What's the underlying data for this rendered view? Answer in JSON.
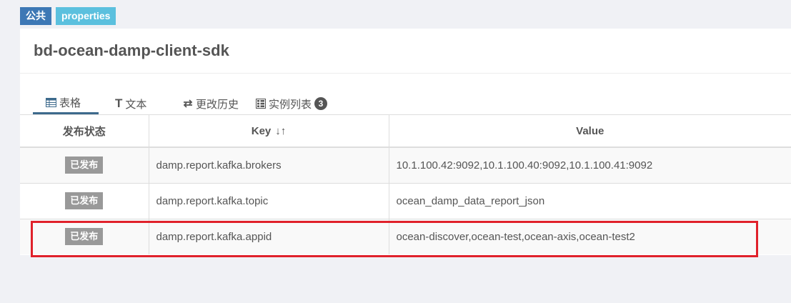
{
  "badges": {
    "scope": "公共",
    "format": "properties"
  },
  "namespace": {
    "title": "bd-ocean-damp-client-sdk"
  },
  "tabs": [
    {
      "label": "表格",
      "icon": "table-icon"
    },
    {
      "label": "文本",
      "icon": "text-icon"
    },
    {
      "label": "更改历史",
      "icon": "history-icon"
    },
    {
      "label": "实例列表",
      "icon": "instance-list-icon",
      "count": "3"
    }
  ],
  "table": {
    "headers": {
      "status": "发布状态",
      "key": "Key",
      "value": "Value"
    },
    "rows": [
      {
        "status": "已发布",
        "key": "damp.report.kafka.brokers",
        "value": "10.1.100.42:9092,10.1.100.40:9092,10.1.100.41:9092"
      },
      {
        "status": "已发布",
        "key": "damp.report.kafka.topic",
        "value": "ocean_damp_data_report_json"
      },
      {
        "status": "已发布",
        "key": "damp.report.kafka.appid",
        "value": "ocean-discover,ocean-test,ocean-axis,ocean-test2"
      }
    ]
  },
  "colors": {
    "highlight": "#e0212b",
    "active_tab": "#3d6a8c",
    "badge_scope": "#3d78b5",
    "badge_format": "#5bc0de"
  }
}
